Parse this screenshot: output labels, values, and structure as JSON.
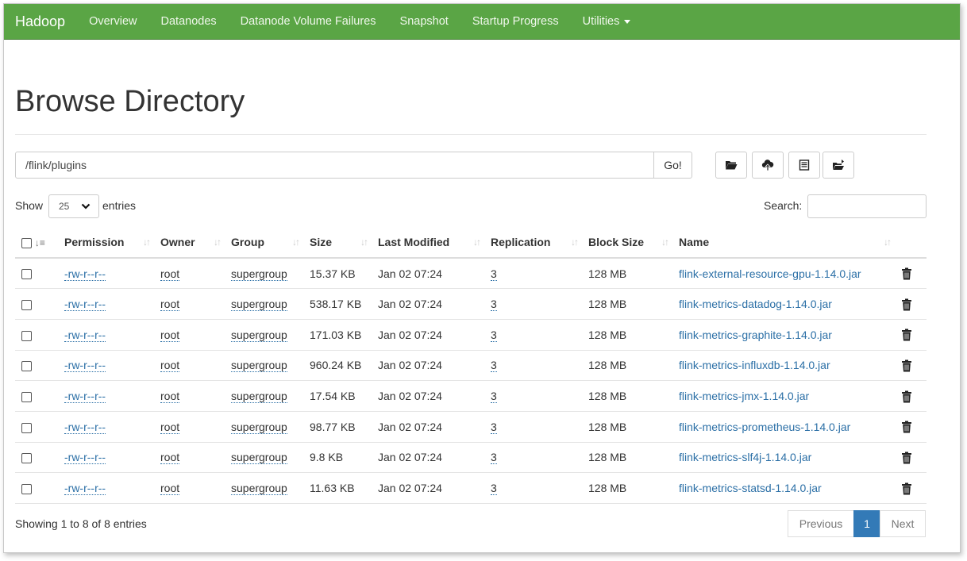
{
  "navbar": {
    "brand": "Hadoop",
    "items": [
      "Overview",
      "Datanodes",
      "Datanode Volume Failures",
      "Snapshot",
      "Startup Progress",
      "Utilities"
    ]
  },
  "page_title": "Browse Directory",
  "path": {
    "value": "/flink/plugins",
    "go_label": "Go!"
  },
  "toolbar_icons": [
    "folder-open-icon",
    "cloud-upload-icon",
    "list-icon",
    "move-icon"
  ],
  "length": {
    "show_label": "Show",
    "value": "25",
    "entries_label": "entries"
  },
  "search": {
    "label": "Search:",
    "value": ""
  },
  "table": {
    "columns": [
      "Permission",
      "Owner",
      "Group",
      "Size",
      "Last Modified",
      "Replication",
      "Block Size",
      "Name"
    ],
    "rows": [
      {
        "permission": "-rw-r--r--",
        "owner": "root",
        "group": "supergroup",
        "size": "15.37 KB",
        "modified": "Jan 02 07:24",
        "replication": "3",
        "block_size": "128 MB",
        "name": "flink-external-resource-gpu-1.14.0.jar"
      },
      {
        "permission": "-rw-r--r--",
        "owner": "root",
        "group": "supergroup",
        "size": "538.17 KB",
        "modified": "Jan 02 07:24",
        "replication": "3",
        "block_size": "128 MB",
        "name": "flink-metrics-datadog-1.14.0.jar"
      },
      {
        "permission": "-rw-r--r--",
        "owner": "root",
        "group": "supergroup",
        "size": "171.03 KB",
        "modified": "Jan 02 07:24",
        "replication": "3",
        "block_size": "128 MB",
        "name": "flink-metrics-graphite-1.14.0.jar"
      },
      {
        "permission": "-rw-r--r--",
        "owner": "root",
        "group": "supergroup",
        "size": "960.24 KB",
        "modified": "Jan 02 07:24",
        "replication": "3",
        "block_size": "128 MB",
        "name": "flink-metrics-influxdb-1.14.0.jar"
      },
      {
        "permission": "-rw-r--r--",
        "owner": "root",
        "group": "supergroup",
        "size": "17.54 KB",
        "modified": "Jan 02 07:24",
        "replication": "3",
        "block_size": "128 MB",
        "name": "flink-metrics-jmx-1.14.0.jar"
      },
      {
        "permission": "-rw-r--r--",
        "owner": "root",
        "group": "supergroup",
        "size": "98.77 KB",
        "modified": "Jan 02 07:24",
        "replication": "3",
        "block_size": "128 MB",
        "name": "flink-metrics-prometheus-1.14.0.jar"
      },
      {
        "permission": "-rw-r--r--",
        "owner": "root",
        "group": "supergroup",
        "size": "9.8 KB",
        "modified": "Jan 02 07:24",
        "replication": "3",
        "block_size": "128 MB",
        "name": "flink-metrics-slf4j-1.14.0.jar"
      },
      {
        "permission": "-rw-r--r--",
        "owner": "root",
        "group": "supergroup",
        "size": "11.63 KB",
        "modified": "Jan 02 07:24",
        "replication": "3",
        "block_size": "128 MB",
        "name": "flink-metrics-statsd-1.14.0.jar"
      }
    ]
  },
  "footer": {
    "info": "Showing 1 to 8 of 8 entries",
    "previous": "Previous",
    "page": "1",
    "next": "Next"
  },
  "colors": {
    "navbar": "#5aa545",
    "link": "#2b6fa6",
    "active_page": "#337ab7"
  }
}
